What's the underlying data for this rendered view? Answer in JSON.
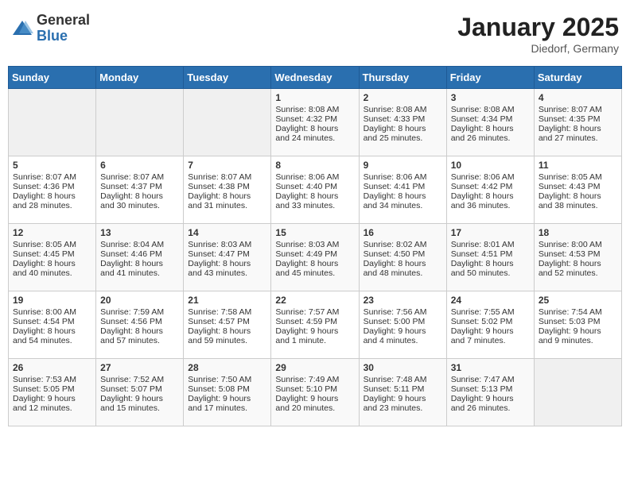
{
  "header": {
    "logo_general": "General",
    "logo_blue": "Blue",
    "month_title": "January 2025",
    "subtitle": "Diedorf, Germany"
  },
  "weekdays": [
    "Sunday",
    "Monday",
    "Tuesday",
    "Wednesday",
    "Thursday",
    "Friday",
    "Saturday"
  ],
  "weeks": [
    [
      {
        "day": "",
        "empty": true
      },
      {
        "day": "",
        "empty": true
      },
      {
        "day": "",
        "empty": true
      },
      {
        "day": "1",
        "rise": "Sunrise: 8:08 AM",
        "set": "Sunset: 4:32 PM",
        "daylight": "Daylight: 8 hours and 24 minutes."
      },
      {
        "day": "2",
        "rise": "Sunrise: 8:08 AM",
        "set": "Sunset: 4:33 PM",
        "daylight": "Daylight: 8 hours and 25 minutes."
      },
      {
        "day": "3",
        "rise": "Sunrise: 8:08 AM",
        "set": "Sunset: 4:34 PM",
        "daylight": "Daylight: 8 hours and 26 minutes."
      },
      {
        "day": "4",
        "rise": "Sunrise: 8:07 AM",
        "set": "Sunset: 4:35 PM",
        "daylight": "Daylight: 8 hours and 27 minutes."
      }
    ],
    [
      {
        "day": "5",
        "rise": "Sunrise: 8:07 AM",
        "set": "Sunset: 4:36 PM",
        "daylight": "Daylight: 8 hours and 28 minutes."
      },
      {
        "day": "6",
        "rise": "Sunrise: 8:07 AM",
        "set": "Sunset: 4:37 PM",
        "daylight": "Daylight: 8 hours and 30 minutes."
      },
      {
        "day": "7",
        "rise": "Sunrise: 8:07 AM",
        "set": "Sunset: 4:38 PM",
        "daylight": "Daylight: 8 hours and 31 minutes."
      },
      {
        "day": "8",
        "rise": "Sunrise: 8:06 AM",
        "set": "Sunset: 4:40 PM",
        "daylight": "Daylight: 8 hours and 33 minutes."
      },
      {
        "day": "9",
        "rise": "Sunrise: 8:06 AM",
        "set": "Sunset: 4:41 PM",
        "daylight": "Daylight: 8 hours and 34 minutes."
      },
      {
        "day": "10",
        "rise": "Sunrise: 8:06 AM",
        "set": "Sunset: 4:42 PM",
        "daylight": "Daylight: 8 hours and 36 minutes."
      },
      {
        "day": "11",
        "rise": "Sunrise: 8:05 AM",
        "set": "Sunset: 4:43 PM",
        "daylight": "Daylight: 8 hours and 38 minutes."
      }
    ],
    [
      {
        "day": "12",
        "rise": "Sunrise: 8:05 AM",
        "set": "Sunset: 4:45 PM",
        "daylight": "Daylight: 8 hours and 40 minutes."
      },
      {
        "day": "13",
        "rise": "Sunrise: 8:04 AM",
        "set": "Sunset: 4:46 PM",
        "daylight": "Daylight: 8 hours and 41 minutes."
      },
      {
        "day": "14",
        "rise": "Sunrise: 8:03 AM",
        "set": "Sunset: 4:47 PM",
        "daylight": "Daylight: 8 hours and 43 minutes."
      },
      {
        "day": "15",
        "rise": "Sunrise: 8:03 AM",
        "set": "Sunset: 4:49 PM",
        "daylight": "Daylight: 8 hours and 45 minutes."
      },
      {
        "day": "16",
        "rise": "Sunrise: 8:02 AM",
        "set": "Sunset: 4:50 PM",
        "daylight": "Daylight: 8 hours and 48 minutes."
      },
      {
        "day": "17",
        "rise": "Sunrise: 8:01 AM",
        "set": "Sunset: 4:51 PM",
        "daylight": "Daylight: 8 hours and 50 minutes."
      },
      {
        "day": "18",
        "rise": "Sunrise: 8:00 AM",
        "set": "Sunset: 4:53 PM",
        "daylight": "Daylight: 8 hours and 52 minutes."
      }
    ],
    [
      {
        "day": "19",
        "rise": "Sunrise: 8:00 AM",
        "set": "Sunset: 4:54 PM",
        "daylight": "Daylight: 8 hours and 54 minutes."
      },
      {
        "day": "20",
        "rise": "Sunrise: 7:59 AM",
        "set": "Sunset: 4:56 PM",
        "daylight": "Daylight: 8 hours and 57 minutes."
      },
      {
        "day": "21",
        "rise": "Sunrise: 7:58 AM",
        "set": "Sunset: 4:57 PM",
        "daylight": "Daylight: 8 hours and 59 minutes."
      },
      {
        "day": "22",
        "rise": "Sunrise: 7:57 AM",
        "set": "Sunset: 4:59 PM",
        "daylight": "Daylight: 9 hours and 1 minute."
      },
      {
        "day": "23",
        "rise": "Sunrise: 7:56 AM",
        "set": "Sunset: 5:00 PM",
        "daylight": "Daylight: 9 hours and 4 minutes."
      },
      {
        "day": "24",
        "rise": "Sunrise: 7:55 AM",
        "set": "Sunset: 5:02 PM",
        "daylight": "Daylight: 9 hours and 7 minutes."
      },
      {
        "day": "25",
        "rise": "Sunrise: 7:54 AM",
        "set": "Sunset: 5:03 PM",
        "daylight": "Daylight: 9 hours and 9 minutes."
      }
    ],
    [
      {
        "day": "26",
        "rise": "Sunrise: 7:53 AM",
        "set": "Sunset: 5:05 PM",
        "daylight": "Daylight: 9 hours and 12 minutes."
      },
      {
        "day": "27",
        "rise": "Sunrise: 7:52 AM",
        "set": "Sunset: 5:07 PM",
        "daylight": "Daylight: 9 hours and 15 minutes."
      },
      {
        "day": "28",
        "rise": "Sunrise: 7:50 AM",
        "set": "Sunset: 5:08 PM",
        "daylight": "Daylight: 9 hours and 17 minutes."
      },
      {
        "day": "29",
        "rise": "Sunrise: 7:49 AM",
        "set": "Sunset: 5:10 PM",
        "daylight": "Daylight: 9 hours and 20 minutes."
      },
      {
        "day": "30",
        "rise": "Sunrise: 7:48 AM",
        "set": "Sunset: 5:11 PM",
        "daylight": "Daylight: 9 hours and 23 minutes."
      },
      {
        "day": "31",
        "rise": "Sunrise: 7:47 AM",
        "set": "Sunset: 5:13 PM",
        "daylight": "Daylight: 9 hours and 26 minutes."
      },
      {
        "day": "",
        "empty": true
      }
    ]
  ]
}
